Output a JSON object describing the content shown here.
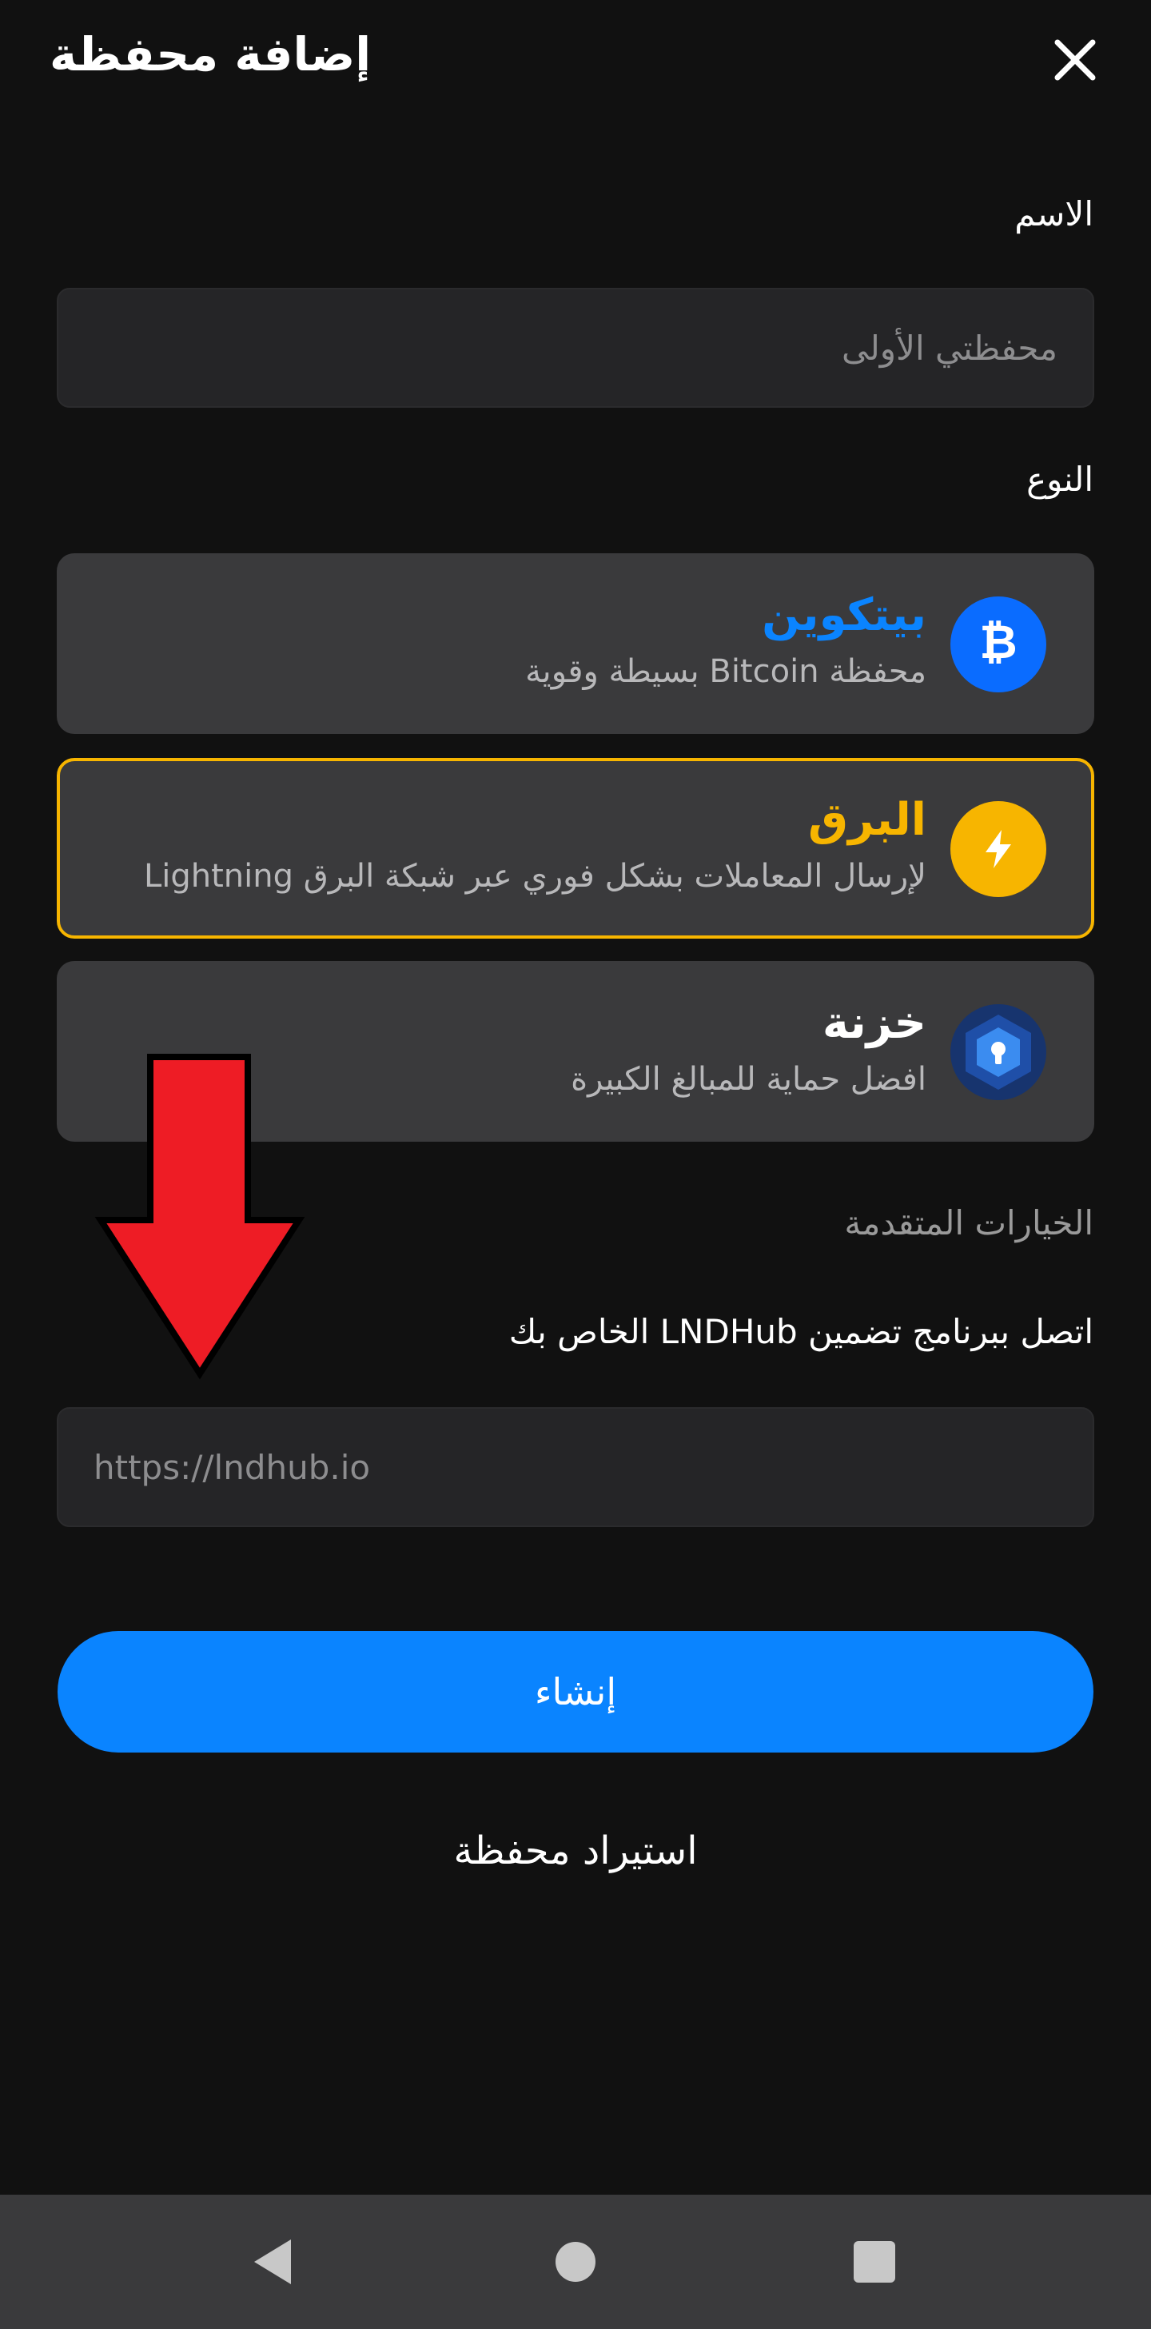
{
  "header": {
    "title": "إضافة محفظة",
    "close_icon": "close-icon"
  },
  "form": {
    "name_label": "الاسم",
    "name_placeholder": "محفظتي الأولى",
    "type_label": "النوع",
    "types": [
      {
        "title": "بيتكوين",
        "description": "محفظة Bitcoin بسيطة وقوية",
        "icon": "bitcoin-icon",
        "title_color": "#0a84ff",
        "icon_bg": "#0a6cff",
        "selected": false
      },
      {
        "title": "البرق",
        "description": "لإرسال المعاملات بشكل فوري عبر شبكة البرق Lightning",
        "icon": "lightning-icon",
        "title_color": "#f7b500",
        "icon_bg": "#f7b500",
        "selected": true
      },
      {
        "title": "خزنة",
        "description": "افضل حماية للمبالغ الكبيرة",
        "icon": "vault-icon",
        "title_color": "#ffffff",
        "icon_bg": "#1f4fa8",
        "selected": false
      }
    ],
    "advanced_label": "الخيارات المتقدمة",
    "lndhub_label": "اتصل ببرنامج تضمين LNDHub الخاص بك",
    "lndhub_placeholder": "https://lndhub.io"
  },
  "actions": {
    "create_label": "إنشاء",
    "import_label": "استيراد محفظة"
  },
  "overlay": {
    "arrow": "down-arrow-icon",
    "arrow_color": "#ee1c25"
  },
  "nav": {
    "back": "back-triangle-icon",
    "home": "home-circle-icon",
    "recents": "recents-square-icon"
  },
  "colors": {
    "accent": "#0a84ff",
    "lightning": "#f7b500",
    "background": "#111111"
  }
}
